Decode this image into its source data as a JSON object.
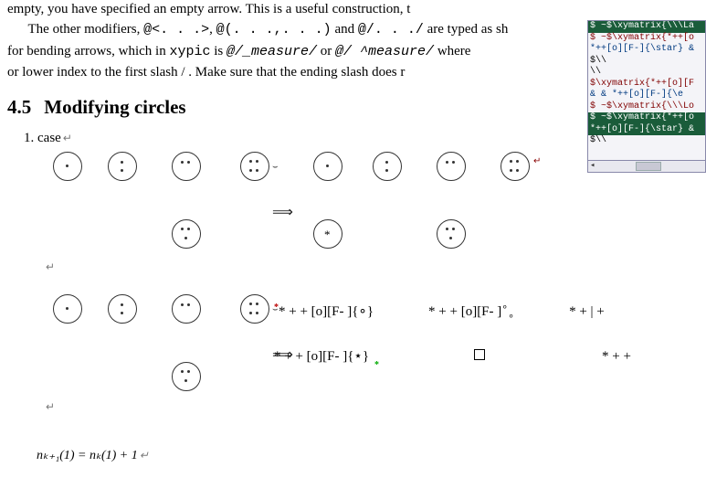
{
  "para1": "empty, you have specified an empty arrow. This is a useful construction, t",
  "para2a": "The other modifiers, ",
  "para2_code1": "@<. . .>",
  "para2b": ", ",
  "para2_code2": "@(. . .,. . .)",
  "para2c": " and ",
  "para2_code3": "@/. . ./",
  "para2d": " are typed as sh",
  "para3a": "for bending arrows, which in ",
  "para3_xypic": "xypic",
  "para3b": " is ",
  "para3_code1": "@/_measure/",
  "para3c": " or ",
  "para3_code2": "@/ ^measure/",
  "para3d": " where",
  "para4": "or lower index to the first slash / . Make sure that the ending slash does r",
  "section_num": "4.5",
  "section_title": "Modifying circles",
  "case_label": "1.  case",
  "formula1": "*  +  +  [o][F- ]{∘}",
  "formula2": "*  +  +  [o][F- ]",
  "formula2_sup": "∘",
  "formula2_sub": "∘",
  "formula3": "*  + | +",
  "formula4": "*  +  +  [o][F- ]{⋆}",
  "formula6": "*  +  +",
  "eq_line": "nₖ₊₁(1) = nₖ(1) + 1",
  "panel": {
    "l1": "$ ~$\\xymatrix{\\\\\\La",
    "l2": "$ ~$\\xymatrix{*++[o",
    "l3": "*++[o][F-]{\\star} &",
    "l4": "$\\\\",
    "l5": "\\\\",
    "l6": "$\\xymatrix{*++[o][F",
    "l7": " &  & *++[o][F-]{\\e",
    "l8": "$ ~$\\xymatrix{\\\\\\Lo",
    "l9": "$ ~$\\xymatrix{*++[o",
    "l10": "*++[o][F-]{\\star} &",
    "l11": "$\\\\"
  }
}
